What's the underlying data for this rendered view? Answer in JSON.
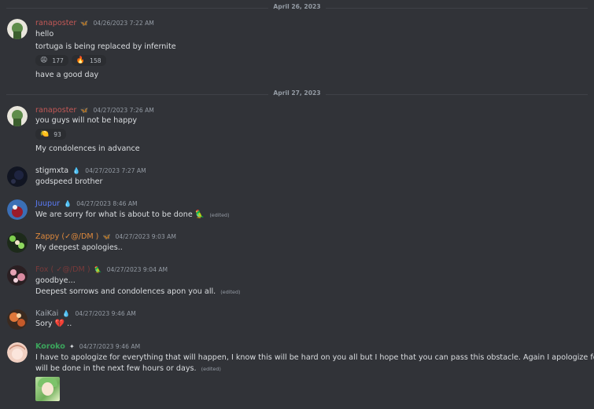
{
  "dividers": [
    "April 26, 2023",
    "April 27, 2023"
  ],
  "messages": [
    {
      "author": "ranaposter",
      "author_color": "#f23f43",
      "badge": "🦋",
      "timestamp": "04/26/2023 7:22 AM",
      "lines": [
        "hello",
        "tortuga is being replaced by infernite"
      ],
      "reactions": [
        {
          "emoji": "😩",
          "count": "177"
        },
        {
          "emoji": "🔥",
          "count": "158"
        }
      ],
      "after": [
        "have a good day"
      ]
    },
    {
      "author": "ranaposter",
      "author_color": "#f23f43",
      "badge": "🦋",
      "timestamp": "04/27/2023 7:26 AM",
      "lines": [
        "you guys will not be happy"
      ],
      "reactions": [
        {
          "emoji": "🍋",
          "count": "93"
        }
      ],
      "after": [
        "My condolences in advance"
      ]
    },
    {
      "author": "stigmxta",
      "author_color": "#dbdee1",
      "badge": "💧",
      "timestamp": "04/27/2023 7:27 AM",
      "lines": [
        "godspeed brother"
      ]
    },
    {
      "author": "Juupur",
      "author_color": "#5865f2",
      "badge": "💧",
      "timestamp": "04/27/2023 8:46 AM",
      "lines": [
        "We are sorry for what is about to be done"
      ],
      "inline_emoji": "🦜",
      "edited": "(edited)"
    },
    {
      "author": "Zappy (✓@/DM )",
      "author_color": "#e67e22",
      "badge": "🦋",
      "timestamp": "04/27/2023 9:03 AM",
      "lines": [
        "My deepest apologies.."
      ]
    },
    {
      "author": "Fox ( ✓@/DM )",
      "author_color": "#c0392b",
      "badge": "🦜",
      "timestamp": "04/27/2023 9:04 AM",
      "lines": [
        "goodbye...",
        "Deepest sorrows and condolences apon you all."
      ],
      "edited": "(edited)"
    },
    {
      "author": "KaiKai",
      "author_color": "#949ba4",
      "badge": "💧",
      "timestamp": "04/27/2023 9:46 AM",
      "lines": [
        "Sory"
      ],
      "inline_emoji": "💔",
      "tail": ".."
    },
    {
      "author": "Koroko",
      "author_color": "#3ba55c",
      "badge": "✦",
      "timestamp": "04/27/2023 9:46 AM",
      "lines": [
        "I have to apologize for everything that will happen, I know this will be hard on you all but I hope that you can pass this obstacle. Again I apologize for what",
        "will be done in the next few hours or days."
      ],
      "edited": "(edited)"
    }
  ]
}
